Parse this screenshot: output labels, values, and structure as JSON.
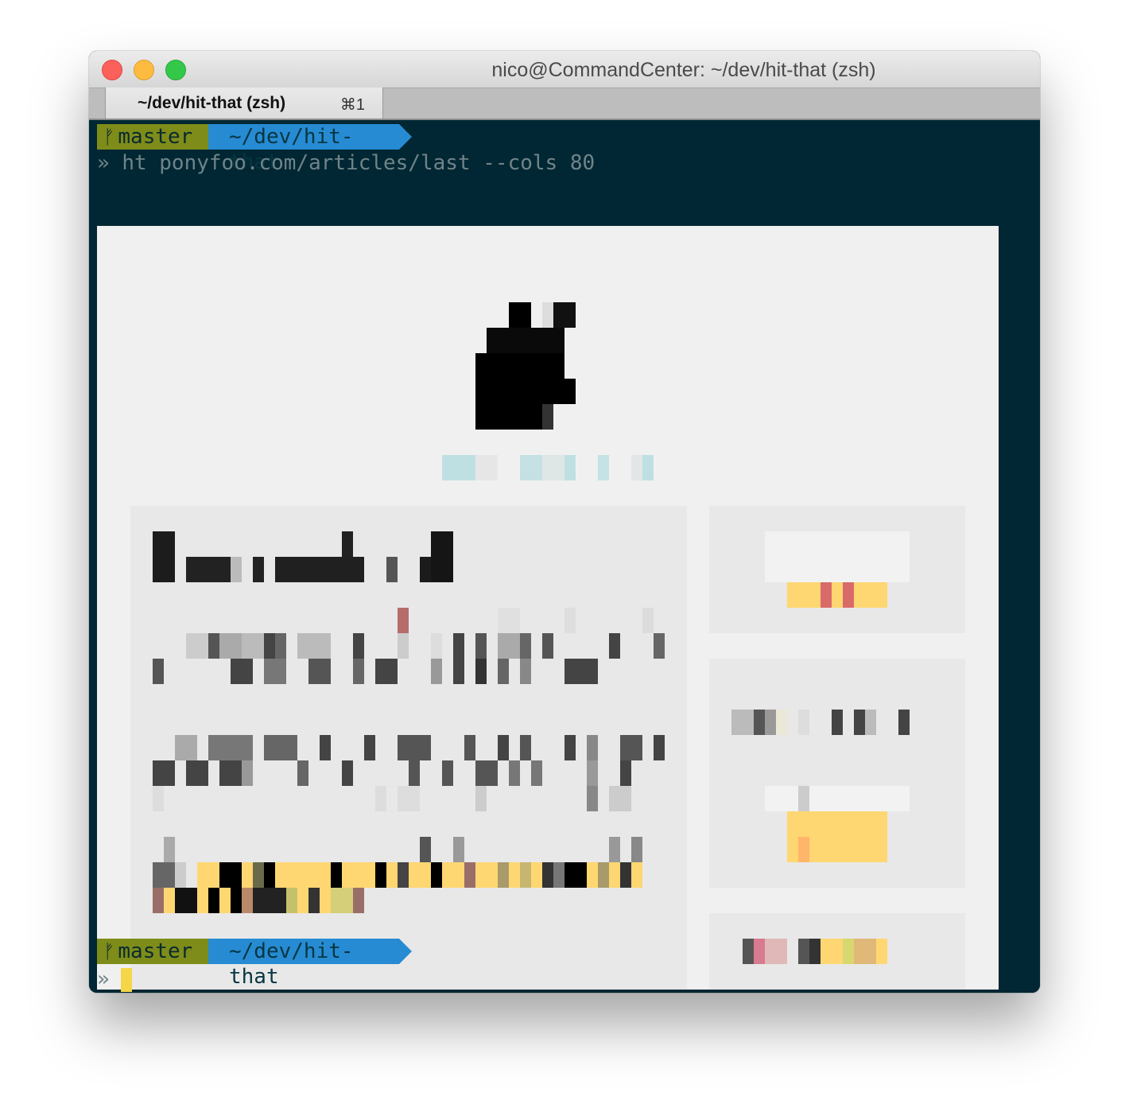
{
  "window": {
    "title": "nico@CommandCenter: ~/dev/hit-that (zsh)",
    "tab_label": "~/dev/hit-that (zsh)",
    "tab_shortcut": "⌘1"
  },
  "prompt_top": {
    "branch_icon": "git-branch-icon",
    "branch": "master",
    "directory": "~/dev/hit-that"
  },
  "command": {
    "symbol": "»",
    "text": "ht ponyfoo.com/articles/last --cols 80"
  },
  "prompt_bottom": {
    "branch": "master",
    "directory": "~/dev/hit-that",
    "symbol": "»"
  },
  "colors": {
    "terminal_bg": "#002733",
    "git_segment": "#7e8c19",
    "dir_segment": "#268bd2",
    "cursor": "#f5d649",
    "command_text": "#6f8489"
  }
}
